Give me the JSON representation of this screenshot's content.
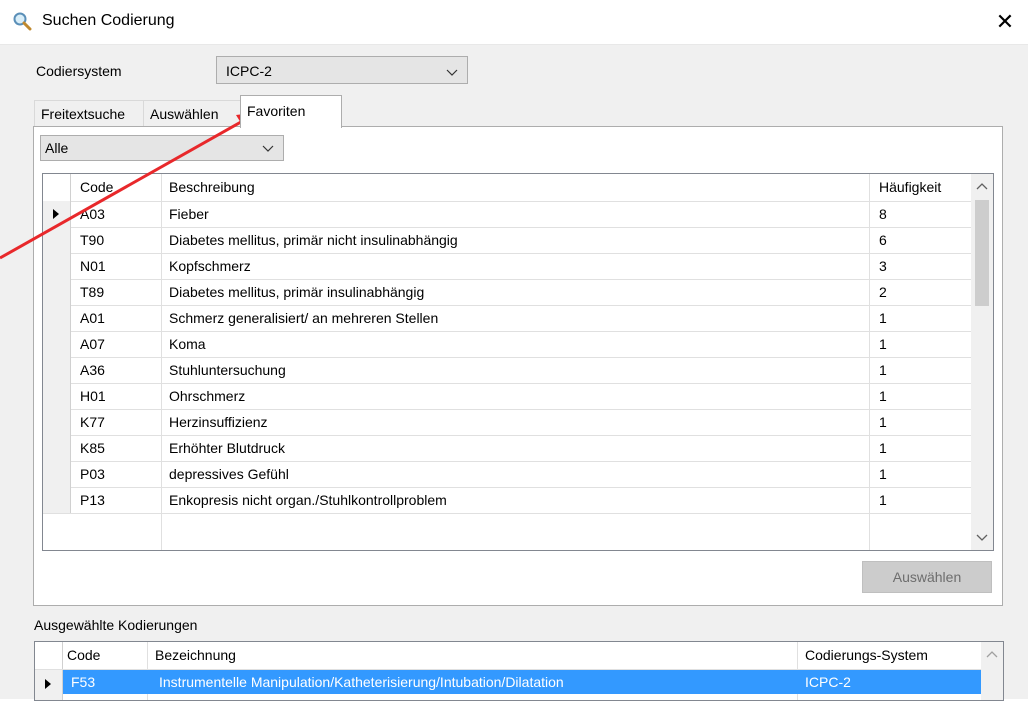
{
  "window": {
    "title": "Suchen Codierung",
    "close": "✕"
  },
  "codier": {
    "label": "Codiersystem",
    "value": "ICPC-2"
  },
  "tabs": [
    {
      "label": "Freitextsuche"
    },
    {
      "label": "Auswählen"
    },
    {
      "label": "Favoriten"
    }
  ],
  "filter": {
    "value": "Alle"
  },
  "grid": {
    "headers": {
      "code": "Code",
      "desc": "Beschreibung",
      "freq": "Häufigkeit"
    },
    "rows": [
      {
        "code": "A03",
        "desc": "Fieber",
        "freq": "8"
      },
      {
        "code": "T90",
        "desc": "Diabetes mellitus, primär nicht insulinabhängig",
        "freq": "6"
      },
      {
        "code": "N01",
        "desc": "Kopfschmerz",
        "freq": "3"
      },
      {
        "code": "T89",
        "desc": "Diabetes mellitus, primär insulinabhängig",
        "freq": "2"
      },
      {
        "code": "A01",
        "desc": "Schmerz generalisiert/ an mehreren Stellen",
        "freq": "1"
      },
      {
        "code": "A07",
        "desc": "Koma",
        "freq": "1"
      },
      {
        "code": "A36",
        "desc": "Stuhluntersuchung",
        "freq": "1"
      },
      {
        "code": "H01",
        "desc": "Ohrschmerz",
        "freq": "1"
      },
      {
        "code": "K77",
        "desc": "Herzinsuffizienz",
        "freq": "1"
      },
      {
        "code": "K85",
        "desc": "Erhöhter Blutdruck",
        "freq": "1"
      },
      {
        "code": "P03",
        "desc": "depressives Gefühl",
        "freq": "1"
      },
      {
        "code": "P13",
        "desc": "Enkopresis nicht organ./Stuhlkontrollproblem",
        "freq": "1"
      }
    ]
  },
  "select_button": "Auswählen",
  "selected": {
    "label": "Ausgewählte Kodierungen",
    "headers": {
      "code": "Code",
      "name": "Bezeichnung",
      "system": "Codierungs-System"
    },
    "row": {
      "code": "F53",
      "name": "Instrumentelle Manipulation/Katheterisierung/Intubation/Dilatation",
      "system": "ICPC-2"
    }
  },
  "colors": {
    "selection": "#3399ff",
    "arrow": "#e8282b"
  }
}
